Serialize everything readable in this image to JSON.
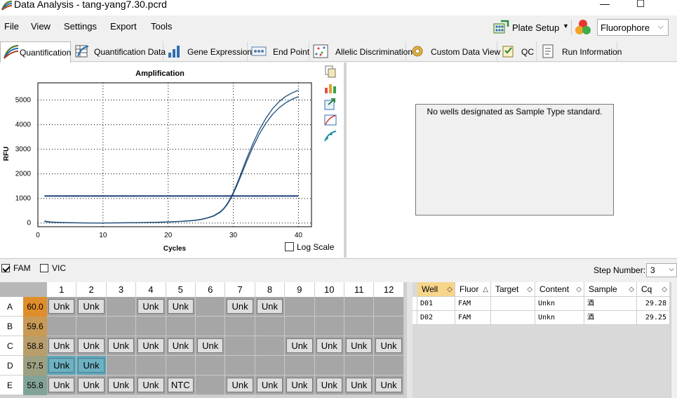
{
  "window": {
    "title": "Data Analysis - tang-yang7.30.pcrd",
    "minimize": "—",
    "maximize": "☐"
  },
  "menu": [
    "File",
    "View",
    "Settings",
    "Export",
    "Tools"
  ],
  "toolbar": {
    "plate_setup": "Plate Setup",
    "fluorophore": "Fluorophore"
  },
  "tabs": [
    {
      "label": "Quantification",
      "icon": "amplification-icon",
      "active": true
    },
    {
      "label": "Quantification Data",
      "icon": "data-table-icon"
    },
    {
      "label": "Gene Expression",
      "icon": "bar-chart-icon"
    },
    {
      "label": "End Point",
      "icon": "end-point-icon"
    },
    {
      "label": "Allelic Discrimination",
      "icon": "scatter-icon"
    },
    {
      "label": "Custom Data View",
      "icon": "gear-icon"
    },
    {
      "label": "QC",
      "icon": "checklist-icon"
    },
    {
      "label": "Run Information",
      "icon": "document-icon"
    }
  ],
  "chart_data": {
    "type": "line",
    "title": "Amplification",
    "xlabel": "Cycles",
    "ylabel": "RFU",
    "xlim": [
      0,
      42
    ],
    "ylim": [
      -150,
      5700
    ],
    "x_ticks": [
      0,
      10,
      20,
      30,
      40
    ],
    "y_ticks": [
      0,
      1000,
      2000,
      3000,
      4000,
      5000
    ],
    "grid": true,
    "threshold": 1100,
    "series": [
      {
        "color": "#1f4e79",
        "x": [
          1,
          2,
          4,
          6,
          8,
          10,
          12,
          14,
          16,
          18,
          20,
          22,
          24,
          25,
          26,
          27,
          28,
          28.5,
          29,
          29.5,
          30,
          30.5,
          31,
          31.5,
          32,
          33,
          34,
          35,
          36,
          37,
          38,
          39,
          40
        ],
        "y": [
          80,
          40,
          20,
          10,
          5,
          5,
          8,
          12,
          20,
          30,
          45,
          70,
          110,
          150,
          210,
          300,
          460,
          580,
          760,
          980,
          1250,
          1560,
          1890,
          2240,
          2580,
          3220,
          3790,
          4260,
          4640,
          4930,
          5140,
          5290,
          5400
        ]
      },
      {
        "color": "#1f4e79",
        "x": [
          1,
          2,
          4,
          6,
          8,
          10,
          12,
          14,
          16,
          18,
          20,
          22,
          24,
          25,
          26,
          27,
          28,
          28.5,
          29,
          29.5,
          30,
          30.5,
          31,
          31.5,
          32,
          33,
          34,
          35,
          36,
          37,
          38,
          39,
          40
        ],
        "y": [
          60,
          30,
          15,
          8,
          4,
          4,
          6,
          10,
          18,
          28,
          42,
          65,
          100,
          140,
          200,
          285,
          440,
          560,
          730,
          940,
          1200,
          1490,
          1810,
          2140,
          2470,
          3080,
          3620,
          4060,
          4410,
          4680,
          4880,
          5030,
          5140
        ]
      }
    ]
  },
  "log_scale_label": "Log Scale",
  "standard_message": "No wells designated as Sample Type standard.",
  "fluors": [
    {
      "label": "FAM",
      "checked": true
    },
    {
      "label": "VIC",
      "checked": false
    }
  ],
  "step": {
    "label": "Step Number:",
    "value": "3"
  },
  "plate": {
    "columns": [
      "1",
      "2",
      "3",
      "4",
      "5",
      "6",
      "7",
      "8",
      "9",
      "10",
      "11",
      "12"
    ],
    "rows": [
      {
        "label": "A",
        "temp": "60.0",
        "color": "#e08d2b",
        "wells": [
          "Unk",
          "Unk",
          "",
          "Unk",
          "Unk",
          "",
          "Unk",
          "Unk",
          "",
          "",
          "",
          ""
        ]
      },
      {
        "label": "B",
        "temp": "59.6",
        "color": "#c99a55",
        "wells": [
          "",
          "",
          "",
          "",
          "",
          "",
          "",
          "",
          "",
          "",
          "",
          ""
        ]
      },
      {
        "label": "C",
        "temp": "58.8",
        "color": "#b99e6b",
        "wells": [
          "Unk",
          "Unk",
          "Unk",
          "Unk",
          "Unk",
          "Unk",
          "",
          "",
          "Unk",
          "Unk",
          "Unk",
          "Unk"
        ]
      },
      {
        "label": "D",
        "temp": "57.5",
        "color": "#9ea082",
        "wells": [
          "Unk",
          "Unk",
          "",
          "",
          "",
          "",
          "",
          "",
          "",
          "",
          "",
          ""
        ],
        "selected": [
          0,
          1
        ]
      },
      {
        "label": "E",
        "temp": "55.8",
        "color": "#82a398",
        "wells": [
          "Unk",
          "Unk",
          "Unk",
          "Unk",
          "NTC",
          "",
          "Unk",
          "Unk",
          "Unk",
          "Unk",
          "Unk",
          "Unk"
        ]
      }
    ]
  },
  "table": {
    "headers": [
      "Well",
      "Fluor",
      "Target",
      "Content",
      "Sample",
      "Cq"
    ],
    "rows": [
      [
        "D01",
        "FAM",
        "",
        "Unkn",
        "酒",
        "29.28"
      ],
      [
        "D02",
        "FAM",
        "",
        "Unkn",
        "酒",
        "29.25"
      ]
    ]
  }
}
